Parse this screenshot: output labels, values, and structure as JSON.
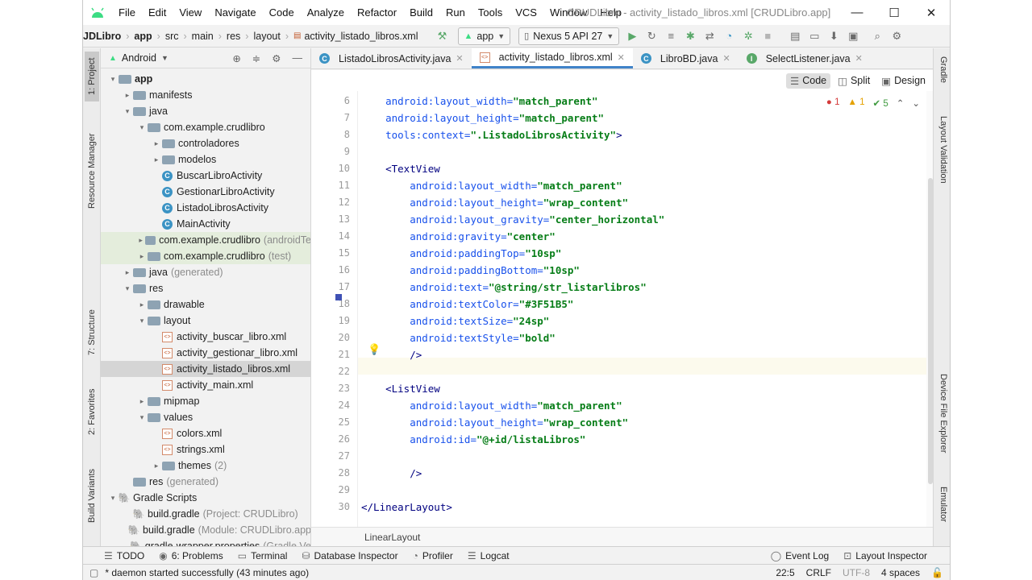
{
  "window": {
    "title": "CRUDLibro - activity_listado_libros.xml [CRUDLibro.app]",
    "menu": [
      "File",
      "Edit",
      "View",
      "Navigate",
      "Code",
      "Analyze",
      "Refactor",
      "Build",
      "Run",
      "Tools",
      "VCS",
      "Window",
      "Help"
    ],
    "controls": {
      "minimize": "—",
      "maximize": "☐",
      "close": "✕"
    }
  },
  "navbar": {
    "breadcrumb": [
      "JDLibro",
      "app",
      "src",
      "main",
      "res",
      "layout",
      "activity_listado_libros.xml"
    ],
    "run_config": "app",
    "device": "Nexus 5 API 27"
  },
  "left_stripe": {
    "tabs": [
      "1: Project",
      "Resource Manager",
      "7: Structure",
      "2: Favorites",
      "Build Variants"
    ]
  },
  "right_stripe": {
    "tabs": [
      "Gradle",
      "Layout Validation",
      "Device File Explorer",
      "Emulator"
    ]
  },
  "project_panel": {
    "view": "Android",
    "tree": [
      {
        "depth": 0,
        "arrow": "▾",
        "icon": "folder",
        "label": "app",
        "bold": true
      },
      {
        "depth": 1,
        "arrow": "▸",
        "icon": "folder",
        "label": "manifests"
      },
      {
        "depth": 1,
        "arrow": "▾",
        "icon": "folder",
        "label": "java"
      },
      {
        "depth": 2,
        "arrow": "▾",
        "icon": "folder",
        "label": "com.example.crudlibro"
      },
      {
        "depth": 3,
        "arrow": "▸",
        "icon": "folder",
        "label": "controladores"
      },
      {
        "depth": 3,
        "arrow": "▸",
        "icon": "folder",
        "label": "modelos"
      },
      {
        "depth": 3,
        "arrow": "",
        "icon": "class",
        "label": "BuscarLibroActivity"
      },
      {
        "depth": 3,
        "arrow": "",
        "icon": "class",
        "label": "GestionarLibroActivity"
      },
      {
        "depth": 3,
        "arrow": "",
        "icon": "class",
        "label": "ListadoLibrosActivity"
      },
      {
        "depth": 3,
        "arrow": "",
        "icon": "class",
        "label": "MainActivity"
      },
      {
        "depth": 2,
        "arrow": "▸",
        "icon": "folder",
        "label": "com.example.crudlibro",
        "hint": "(androidTe",
        "style": "grn"
      },
      {
        "depth": 2,
        "arrow": "▸",
        "icon": "folder",
        "label": "com.example.crudlibro",
        "hint": "(test)",
        "style": "grn"
      },
      {
        "depth": 1,
        "arrow": "▸",
        "icon": "folder",
        "label": "java",
        "hint": "(generated)"
      },
      {
        "depth": 1,
        "arrow": "▾",
        "icon": "folder",
        "label": "res"
      },
      {
        "depth": 2,
        "arrow": "▸",
        "icon": "folder",
        "label": "drawable"
      },
      {
        "depth": 2,
        "arrow": "▾",
        "icon": "folder",
        "label": "layout"
      },
      {
        "depth": 3,
        "arrow": "",
        "icon": "xml",
        "label": "activity_buscar_libro.xml"
      },
      {
        "depth": 3,
        "arrow": "",
        "icon": "xml",
        "label": "activity_gestionar_libro.xml"
      },
      {
        "depth": 3,
        "arrow": "",
        "icon": "xml",
        "label": "activity_listado_libros.xml",
        "style": "sel"
      },
      {
        "depth": 3,
        "arrow": "",
        "icon": "xml",
        "label": "activity_main.xml"
      },
      {
        "depth": 2,
        "arrow": "▸",
        "icon": "folder",
        "label": "mipmap"
      },
      {
        "depth": 2,
        "arrow": "▾",
        "icon": "folder",
        "label": "values"
      },
      {
        "depth": 3,
        "arrow": "",
        "icon": "xml",
        "label": "colors.xml"
      },
      {
        "depth": 3,
        "arrow": "",
        "icon": "xml",
        "label": "strings.xml"
      },
      {
        "depth": 3,
        "arrow": "▸",
        "icon": "folder",
        "label": "themes",
        "hint": "(2)"
      },
      {
        "depth": 1,
        "arrow": "",
        "icon": "folder",
        "label": "res",
        "hint": "(generated)"
      },
      {
        "depth": 0,
        "arrow": "▾",
        "icon": "gradle",
        "label": "Gradle Scripts"
      },
      {
        "depth": 1,
        "arrow": "",
        "icon": "gradle",
        "label": "build.gradle",
        "hint": "(Project: CRUDLibro)"
      },
      {
        "depth": 1,
        "arrow": "",
        "icon": "gradle",
        "label": "build.gradle",
        "hint": "(Module: CRUDLibro.app"
      },
      {
        "depth": 1,
        "arrow": "",
        "icon": "gradle",
        "label": "gradle-wrapper.properties",
        "hint": "(Gradle Ve"
      }
    ]
  },
  "editor_tabs": [
    {
      "label": "ListadoLibrosActivity.java",
      "icon": "class"
    },
    {
      "label": "activity_listado_libros.xml",
      "icon": "xml",
      "active": true
    },
    {
      "label": "LibroBD.java",
      "icon": "class"
    },
    {
      "label": "SelectListener.java",
      "icon": "interface"
    }
  ],
  "modes": [
    "Code",
    "Split",
    "Design"
  ],
  "inspections": {
    "errors": "1",
    "warnings": "1",
    "ok": "5"
  },
  "code_lines": [
    {
      "n": "6",
      "parts": [
        [
          "attr",
          "    android:layout_width="
        ],
        [
          "val",
          "\"match_parent\""
        ]
      ]
    },
    {
      "n": "7",
      "parts": [
        [
          "attr",
          "    android:layout_height="
        ],
        [
          "val",
          "\"match_parent\""
        ]
      ]
    },
    {
      "n": "8",
      "parts": [
        [
          "attr",
          "    tools:context="
        ],
        [
          "val",
          "\".ListadoLibrosActivity\""
        ],
        [
          "tag",
          ">"
        ]
      ]
    },
    {
      "n": "9",
      "parts": []
    },
    {
      "n": "10",
      "parts": [
        [
          "tag",
          "    <TextView"
        ]
      ]
    },
    {
      "n": "11",
      "parts": [
        [
          "attr",
          "        android:layout_width="
        ],
        [
          "val",
          "\"match_parent\""
        ]
      ]
    },
    {
      "n": "12",
      "parts": [
        [
          "attr",
          "        android:layout_height="
        ],
        [
          "val",
          "\"wrap_content\""
        ]
      ]
    },
    {
      "n": "13",
      "parts": [
        [
          "attr",
          "        android:layout_gravity="
        ],
        [
          "val",
          "\"center_horizontal\""
        ]
      ]
    },
    {
      "n": "14",
      "parts": [
        [
          "attr",
          "        android:gravity="
        ],
        [
          "val",
          "\"center\""
        ]
      ]
    },
    {
      "n": "15",
      "parts": [
        [
          "attr",
          "        android:paddingTop="
        ],
        [
          "val",
          "\"10sp\""
        ]
      ]
    },
    {
      "n": "16",
      "parts": [
        [
          "attr",
          "        android:paddingBottom="
        ],
        [
          "val",
          "\"10sp\""
        ]
      ]
    },
    {
      "n": "17",
      "parts": [
        [
          "attr",
          "        android:text="
        ],
        [
          "val",
          "\"@string/str_listarlibros\""
        ]
      ]
    },
    {
      "n": "18",
      "parts": [
        [
          "attr",
          "        android:textColor="
        ],
        [
          "val",
          "\"#3F51B5\""
        ]
      ]
    },
    {
      "n": "19",
      "parts": [
        [
          "attr",
          "        android:textSize="
        ],
        [
          "val",
          "\"24sp\""
        ]
      ]
    },
    {
      "n": "20",
      "parts": [
        [
          "attr",
          "        android:textStyle="
        ],
        [
          "val",
          "\"bold\""
        ]
      ]
    },
    {
      "n": "21",
      "parts": [
        [
          "tag",
          "        />"
        ]
      ]
    },
    {
      "n": "22",
      "parts": []
    },
    {
      "n": "23",
      "parts": [
        [
          "tag",
          "    <ListView"
        ]
      ]
    },
    {
      "n": "24",
      "parts": [
        [
          "attr",
          "        android:layout_width="
        ],
        [
          "val",
          "\"match_parent\""
        ]
      ]
    },
    {
      "n": "25",
      "parts": [
        [
          "attr",
          "        android:layout_height="
        ],
        [
          "val",
          "\"wrap_content\""
        ]
      ]
    },
    {
      "n": "26",
      "parts": [
        [
          "attr",
          "        android:id="
        ],
        [
          "val",
          "\"@+id/listaLibros\""
        ]
      ]
    },
    {
      "n": "27",
      "parts": []
    },
    {
      "n": "28",
      "parts": [
        [
          "tag",
          "        />"
        ]
      ]
    },
    {
      "n": "29",
      "parts": []
    },
    {
      "n": "30",
      "parts": [
        [
          "tag",
          "</LinearLayout>"
        ]
      ]
    }
  ],
  "current_line": "22",
  "editor_breadcrumb": "LinearLayout",
  "tool_windows": [
    "TODO",
    "6: Problems",
    "Terminal",
    "Database Inspector",
    "Profiler",
    "Logcat"
  ],
  "tool_windows_right": [
    "Event Log",
    "Layout Inspector"
  ],
  "status": {
    "message": "* daemon started successfully (43 minutes ago)",
    "position": "22:5",
    "line_sep": "CRLF",
    "encoding": "UTF-8",
    "indent": "4 spaces"
  },
  "colors": {
    "accent": "#4083c9",
    "value": "#067d17",
    "tag": "#000080",
    "attr": "#1750eb",
    "swatch": "#3F51B5"
  }
}
